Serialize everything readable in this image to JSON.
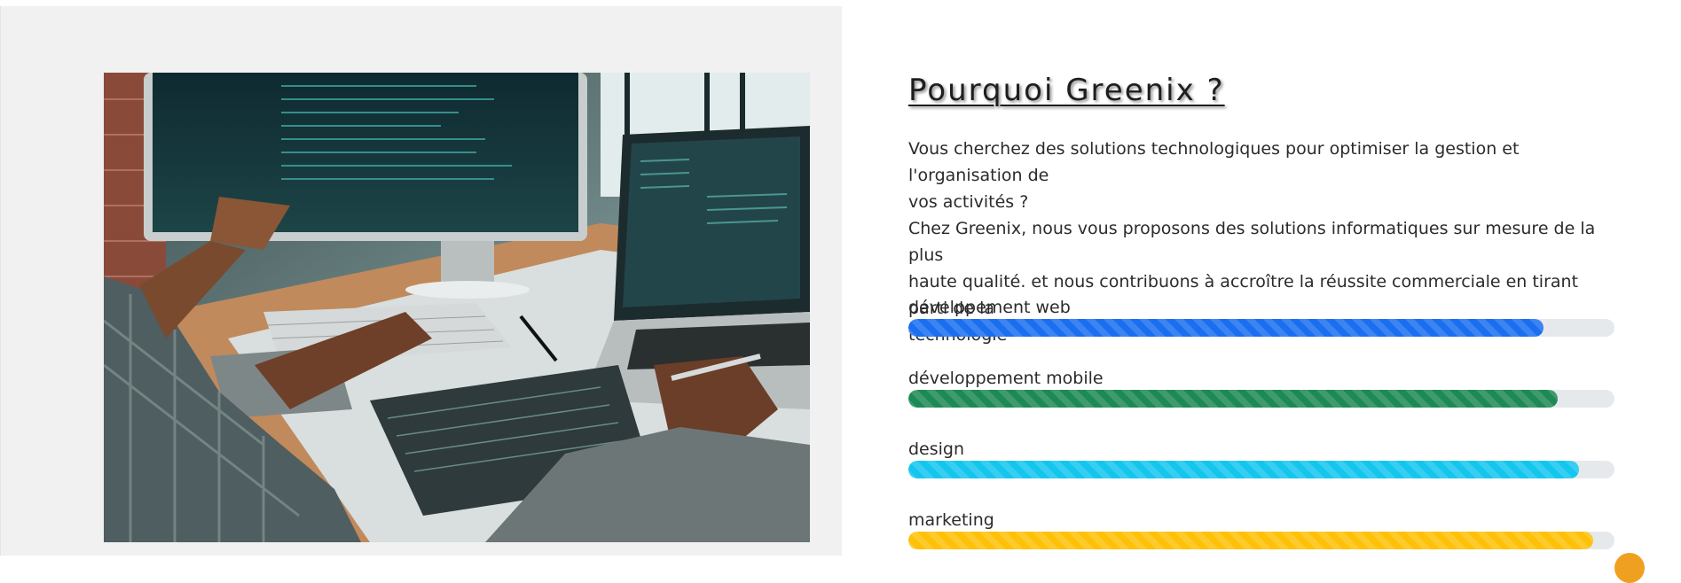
{
  "section": {
    "title": "Pourquoi Greenix ?",
    "intro_lines": [
      "Vous cherchez des solutions technologiques pour optimiser la gestion et l'organisation de",
      "vos activités ?",
      "Chez Greenix, nous vous proposons des solutions informatiques sur mesure de la plus",
      "haute qualité. et nous contribuons à accroître la réussite commerciale en tirant parti de la",
      "technologie"
    ]
  },
  "skills": [
    {
      "label": "dévelppement web",
      "percent": 90,
      "color": "#1a6ef0"
    },
    {
      "label": "développement mobile",
      "percent": 92,
      "color": "#1d8a55"
    },
    {
      "label": "design",
      "percent": 95,
      "color": "#14c6ee"
    },
    {
      "label": "marketing",
      "percent": 97,
      "color": "#ffc107"
    }
  ],
  "image": {
    "icon": "developers-workspace-photo"
  },
  "scroll_button": {
    "icon": "scroll-top-icon",
    "color": "#f0a020"
  }
}
